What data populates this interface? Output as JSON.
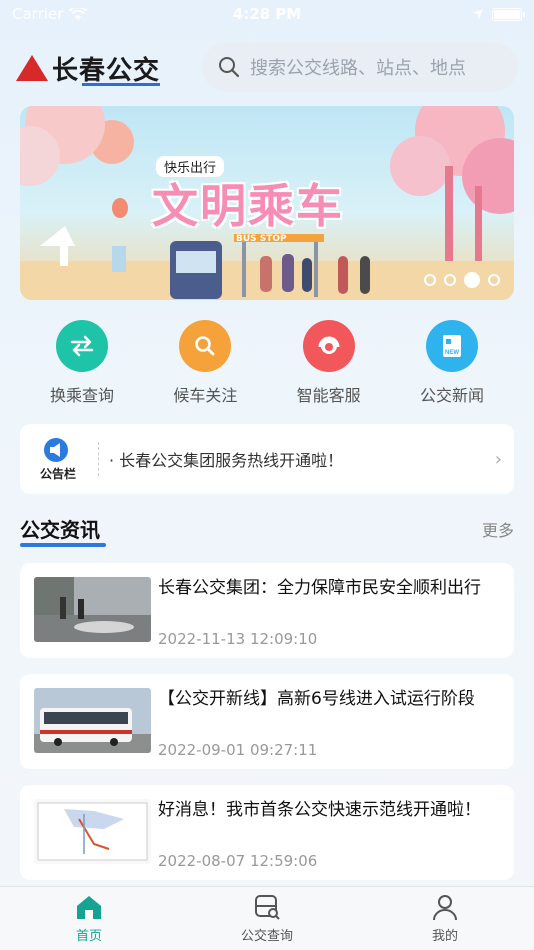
{
  "status_bar": {
    "carrier": "Carrier",
    "time": "4:28 PM"
  },
  "header": {
    "logo_text": "长春公交",
    "search_placeholder": "搜索公交线路、站点、地点"
  },
  "banner": {
    "subtitle": "快乐出行",
    "title": "文明乘车",
    "sign": "BUS STOP",
    "active_index": 2,
    "total": 4
  },
  "quick_actions": [
    {
      "label": "换乘查询",
      "icon": "transfer-icon",
      "color": "#1fc3a7"
    },
    {
      "label": "候车关注",
      "icon": "search-icon",
      "color": "#f6a23a"
    },
    {
      "label": "智能客服",
      "icon": "headset-icon",
      "color": "#f2575c"
    },
    {
      "label": "公交新闻",
      "icon": "news-icon",
      "color": "#2fb3ef"
    }
  ],
  "notice": {
    "badge": "公告栏",
    "text": "· 长春公交集团服务热线开通啦！"
  },
  "news_section": {
    "title": "公交资讯",
    "more": "更多"
  },
  "news": [
    {
      "title": "长春公交集团：全力保障市民安全顺利出行",
      "time": "2022-11-13 12:09:10"
    },
    {
      "title": "【公交开新线】高新6号线进入试运行阶段",
      "time": "2022-09-01 09:27:11"
    },
    {
      "title": "好消息！我市首条公交快速示范线开通啦！",
      "time": "2022-08-07 12:59:06"
    }
  ],
  "tabbar": [
    {
      "label": "首页",
      "icon": "home-icon",
      "active": true
    },
    {
      "label": "公交查询",
      "icon": "bus-search-icon",
      "active": false
    },
    {
      "label": "我的",
      "icon": "user-icon",
      "active": false
    }
  ],
  "colors": {
    "accent": "#16a394",
    "brand_red": "#d7282a",
    "section_underline": "#2b7ae0"
  }
}
